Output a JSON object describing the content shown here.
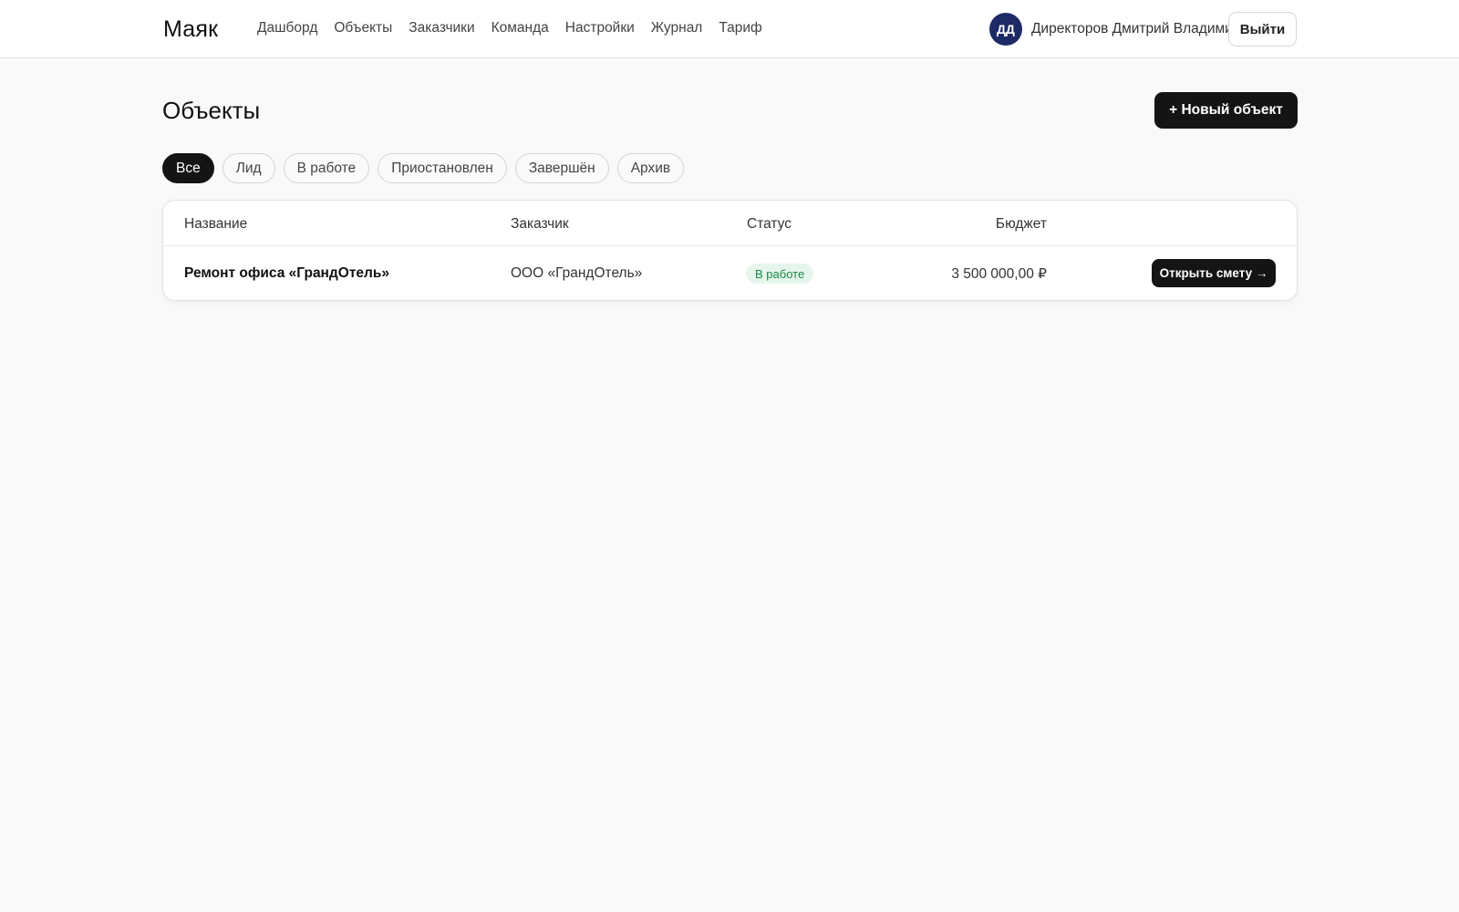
{
  "app": {
    "brand": "Маяк"
  },
  "nav": [
    {
      "label": "Дашборд"
    },
    {
      "label": "Объекты"
    },
    {
      "label": "Заказчики"
    },
    {
      "label": "Команда"
    },
    {
      "label": "Настройки"
    },
    {
      "label": "Журнал"
    },
    {
      "label": "Тариф"
    }
  ],
  "user": {
    "initials": "ДД",
    "name": "Директоров Дмитрий Владимирович",
    "logout_label": "Выйти",
    "avatar_color": "#1e2a66"
  },
  "page": {
    "title": "Объекты",
    "new_button_label": "+ Новый объект"
  },
  "filters": [
    {
      "label": "Все",
      "active": true
    },
    {
      "label": "Лид",
      "active": false
    },
    {
      "label": "В работе",
      "active": false
    },
    {
      "label": "Приостановлен",
      "active": false
    },
    {
      "label": "Завершён",
      "active": false
    },
    {
      "label": "Архив",
      "active": false
    }
  ],
  "table": {
    "columns": [
      "Название",
      "Заказчик",
      "Статус",
      "Бюджет"
    ],
    "rows": [
      {
        "name": "Ремонт офиса «ГрандОтель»",
        "customer": "ООО «ГрандОтель»",
        "status": "В работе",
        "budget": "3 500 000,00 ₽",
        "action_label": "Открыть смету →"
      }
    ]
  },
  "colors": {
    "status_in_work_bg": "#e6f6ec",
    "status_in_work_text": "#178a45",
    "primary_button": "#141414"
  }
}
